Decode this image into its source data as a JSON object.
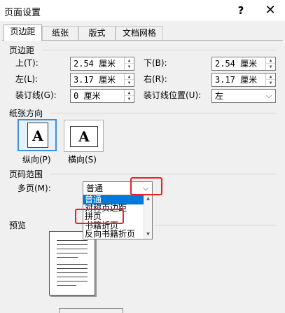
{
  "window": {
    "title": "页面设置",
    "help": "?",
    "close": "✕"
  },
  "tabs": [
    {
      "label": "页边距",
      "active": true
    },
    {
      "label": "纸张"
    },
    {
      "label": "版式"
    },
    {
      "label": "文档网格"
    }
  ],
  "margins": {
    "section_title": "页边距",
    "top": {
      "label": "上(T):",
      "value": "2.54 厘米"
    },
    "bottom": {
      "label": "下(B):",
      "value": "2.54 厘米"
    },
    "left": {
      "label": "左(L):",
      "value": "3.17 厘米"
    },
    "right": {
      "label": "右(R):",
      "value": "3.17 厘米"
    },
    "gutter": {
      "label": "装订线(G):",
      "value": "0 厘米"
    },
    "gutter_pos": {
      "label": "装订线位置(U):",
      "value": "左"
    }
  },
  "orientation": {
    "section_title": "纸张方向",
    "portrait": {
      "label": "纵向(P)",
      "glyph": "A",
      "selected": true
    },
    "landscape": {
      "label": "横向(S)",
      "glyph": "A"
    }
  },
  "pages": {
    "section_title": "页码范围",
    "multiple_label": "多页(M):",
    "selected": "普通",
    "options": [
      "普通",
      "对称页边距",
      "拼页",
      "书籍折页",
      "反向书籍折页"
    ]
  },
  "preview": {
    "section_title": "预览"
  },
  "colors": {
    "accent": "#0078d7",
    "highlight": "#e8222a",
    "selected_border": "#3d8fdc"
  },
  "icons": {
    "spinner": "up-down-arrows",
    "combo": "chevron-down-icon"
  }
}
